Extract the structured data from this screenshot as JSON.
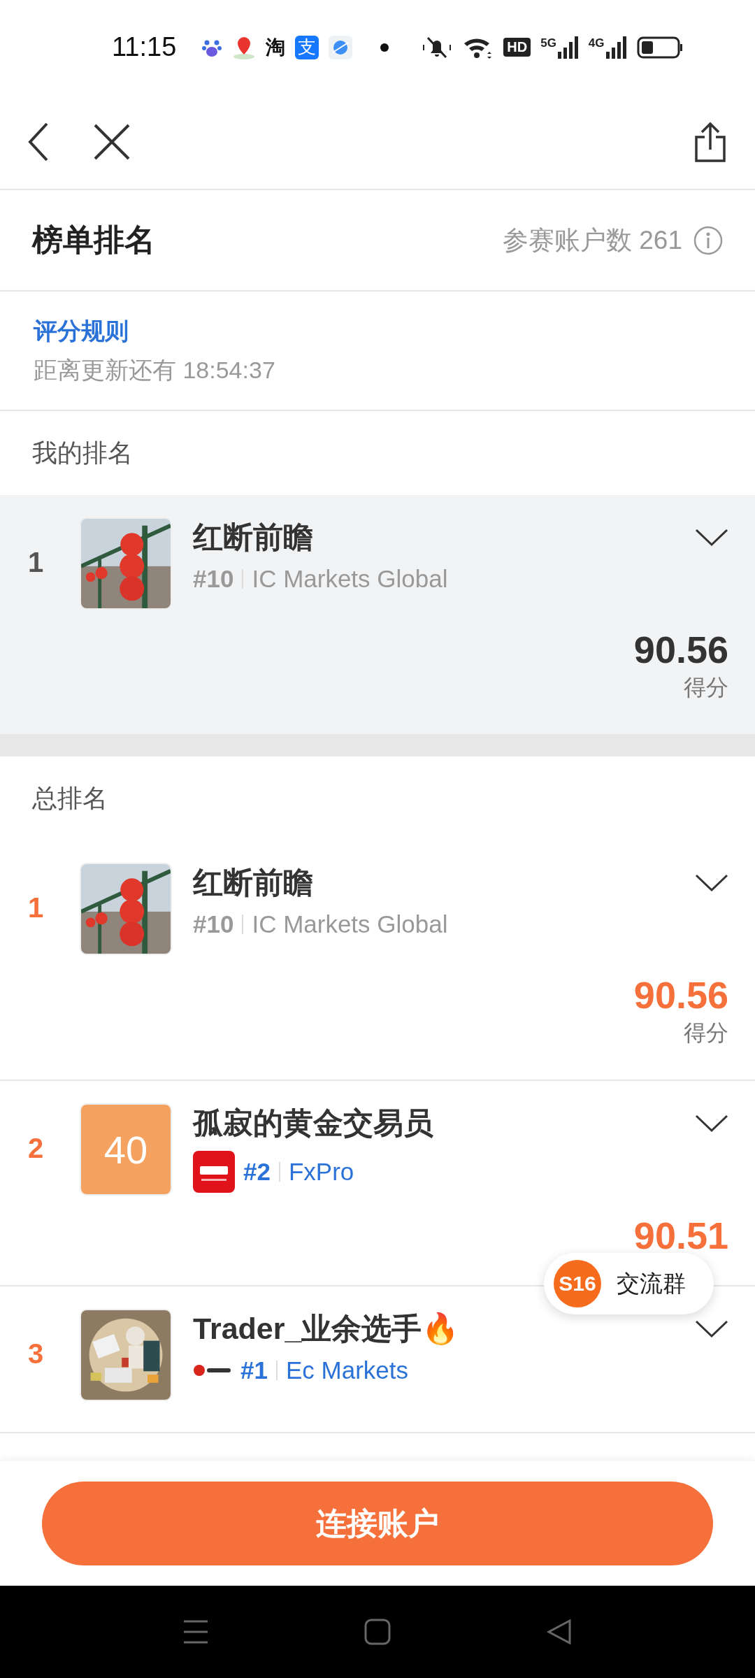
{
  "status_bar": {
    "time": "11:15",
    "notification_icons": [
      {
        "kind": "paw"
      },
      {
        "kind": "pin"
      },
      {
        "kind": "glyph",
        "text": "淘"
      },
      {
        "kind": "tile",
        "text": "支"
      },
      {
        "kind": "planet"
      }
    ],
    "hd": "HD",
    "networks": [
      "5G",
      "4G"
    ]
  },
  "header": {
    "title": "榜单排名",
    "count_label": "参赛账户数 261"
  },
  "rules": {
    "link": "评分规则",
    "countdown": "距离更新还有 18:54:37"
  },
  "my_ranking": {
    "heading": "我的排名",
    "entries": [
      {
        "rank": "1",
        "highlighted": false,
        "name": "红断前瞻",
        "broker_rank": "#10",
        "broker": "IC Markets Global",
        "score": "90.56",
        "score_label": "得分"
      }
    ]
  },
  "overall_ranking": {
    "heading": "总排名",
    "entries": [
      {
        "rank": "1",
        "highlighted": true,
        "name": "红断前瞻",
        "broker_rank": "#10",
        "broker": "IC Markets Global",
        "score": "90.56",
        "score_label": "得分"
      },
      {
        "rank": "2",
        "highlighted": true,
        "avatar": {
          "kind": "text",
          "text": "40"
        },
        "name": "孤寂的黄金交易员",
        "broker_rank": "#2",
        "broker": "FxPro",
        "logo": {
          "kind": "square"
        },
        "score": "90.51"
      },
      {
        "rank": "3",
        "highlighted": true,
        "avatar": {
          "kind": "illustration"
        },
        "name": "Trader_业余选手🔥",
        "broker_rank": "#1",
        "broker": "Ec Markets",
        "logo": {
          "kind": "wordmark"
        }
      }
    ]
  },
  "chat_button": {
    "badge": "S16",
    "label": "交流群"
  },
  "connect_button": "连接账户"
}
